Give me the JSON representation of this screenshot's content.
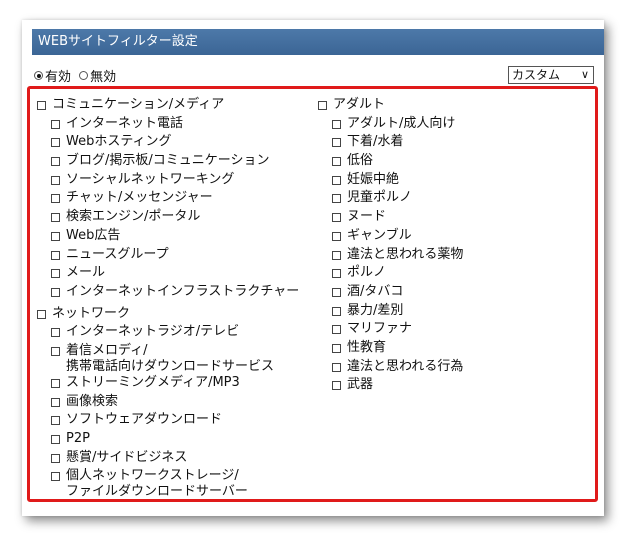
{
  "header": {
    "title": "WEBサイトフィルター設定"
  },
  "mode": {
    "enabled_label": "有効",
    "disabled_label": "無効",
    "selected": "enabled",
    "profile_select_value": "カスタム"
  },
  "categories": {
    "communication": {
      "label": "コミュニケーション/メディア",
      "items": [
        "インターネット電話",
        "Webホスティング",
        "ブログ/掲示板/コミュニケーション",
        "ソーシャルネットワーキング",
        "チャット/メッセンジャー",
        "検索エンジン/ポータル",
        "Web広告",
        "ニュースグループ",
        "メール",
        "インターネットインフラストラクチャー"
      ]
    },
    "network": {
      "label": "ネットワーク",
      "items": [
        "インターネットラジオ/テレビ",
        "着信メロディ/\n携帯電話向けダウンロードサービス",
        "ストリーミングメディア/MP3",
        "画像検索",
        "ソフトウェアダウンロード",
        "P2P",
        "懸賞/サイドビジネス",
        "個人ネットワークストレージ/\nファイルダウンロードサーバー"
      ]
    },
    "adult": {
      "label": "アダルト",
      "items": [
        "アダルト/成人向け",
        "下着/水着",
        "低俗",
        "妊娠中絶",
        "児童ポルノ",
        "ヌード",
        "ギャンブル",
        "違法と思われる薬物",
        "ポルノ",
        "酒/タバコ",
        "暴力/差別",
        "マリファナ",
        "性教育",
        "違法と思われる行為",
        "武器"
      ]
    }
  }
}
